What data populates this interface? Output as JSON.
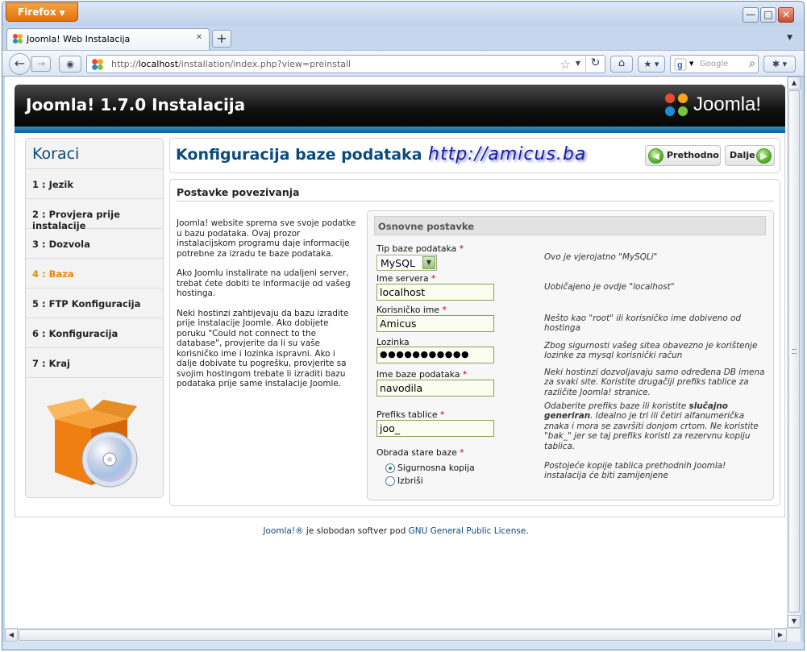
{
  "browser": {
    "app_button": "Firefox",
    "tab_title": "Joomla! Web Instalacija",
    "url_prefix": "http://",
    "url_host": "localhost",
    "url_path": "/installation/index.php?view=preinstall",
    "search_placeholder": "Google"
  },
  "header": {
    "title": "Joomla! 1.7.0 Instalacija",
    "logo_text": "Joomla!"
  },
  "sidebar": {
    "title": "Koraci",
    "steps": [
      {
        "label": "1 : Jezik"
      },
      {
        "label": "2 : Provjera prije instalacije"
      },
      {
        "label": "3 : Dozvola"
      },
      {
        "label": "4 : Baza"
      },
      {
        "label": "5 : FTP Konfiguracija"
      },
      {
        "label": "6 : Konfiguracija"
      },
      {
        "label": "7 : Kraj"
      }
    ],
    "active_step": 3
  },
  "page": {
    "title": "Konfiguracija baze podataka",
    "watermark": "http://amicus.ba",
    "prev_label": "Prethodno",
    "next_label": "Dalje",
    "section_title": "Postavke povezivanja",
    "intro": [
      "Joomla! website sprema sve svoje podatke u bazu podataka. Ovaj prozor instalacijskom programu daje informacije potrebne za izradu te baze podataka.",
      "Ako Joomlu instalirate na udaljeni server, trebat ćete dobiti te informacije od vašeg hostinga.",
      "Neki hostinzi zahtijevaju da bazu izradite prije instalacije Joomle. Ako dobijete poruku \"Could not connect to the database\", provjerite da li su vaše korisničko ime i lozinka ispravni. Ako i dalje dobivate tu pogrešku, provjerite sa svojim hostingom trebate li izraditi bazu podataka prije same instalacije Joomle."
    ]
  },
  "form": {
    "legend": "Osnovne postavke",
    "db_type": {
      "label": "Tip baze podataka",
      "value": "MySQL",
      "hint": "Ovo je vjerojatno \"MySQLi\""
    },
    "host": {
      "label": "Ime servera",
      "value": "localhost",
      "hint": "Uobičajeno je ovdje \"localhost\""
    },
    "user": {
      "label": "Korisničko ime",
      "value": "Amicus",
      "hint": "Nešto kao \"root\" ili korisničko ime dobiveno od hostinga"
    },
    "password": {
      "label": "Lozinka",
      "value": "●●●●●●●●●●●",
      "hint": "Zbog sigurnosti vašeg sitea obavezno je korištenje lozinke za mysql korisnički račun"
    },
    "db_name": {
      "label": "Ime baze podataka",
      "value": "navodila",
      "hint": "Neki hostinzi dozvoljavaju samo određena DB imena za svaki site. Koristite drugačiji prefiks tablice za različite Joomla! stranice."
    },
    "prefix": {
      "label": "Prefiks tablice",
      "value": "joo_",
      "hint_pre": "Odaberite prefiks baze ili koristite ",
      "hint_bold": "slučajno generiran",
      "hint_post": ". Idealno je tri ili četiri alfanumerička znaka i mora se završiti donjom crtom. Ne koristite \"bak_\" jer se taj prefiks koristi za rezervnu kopiju tablica."
    },
    "old_db": {
      "label": "Obrada stare baze",
      "option_backup": "Sigurnosna kopija",
      "option_delete": "Izbriši",
      "hint": "Postojeće kopije tablica prethodnih Joomla! instalacija će biti zamijenjene"
    },
    "required_mark": "*"
  },
  "footer": {
    "part1": "Joomla!®",
    "part2": " je slobodan softver pod ",
    "part3": "GNU General Public License",
    "part4": "."
  },
  "colors": {
    "accent_blue": "#0b4a7c",
    "active_orange": "#e5860a",
    "header_stripe": "#1a76b2"
  }
}
